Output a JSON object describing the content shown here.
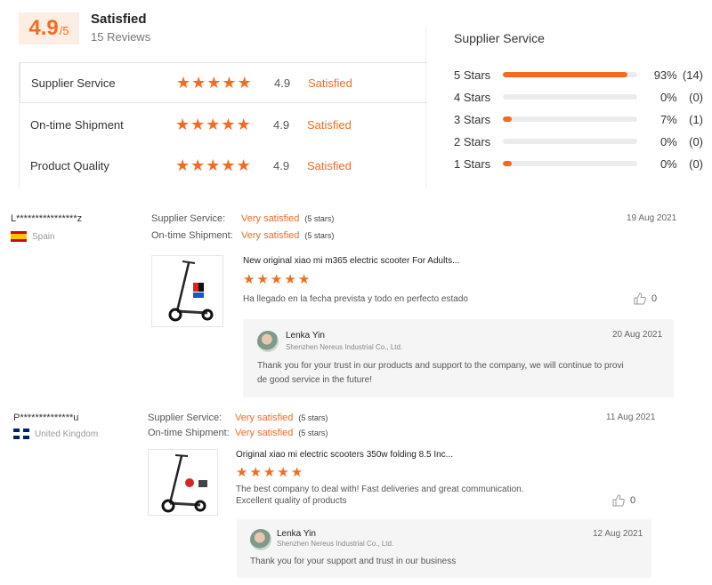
{
  "summary": {
    "score": "4.9",
    "score_of": "/5",
    "status": "Satisfied",
    "reviews_count": "15 Reviews",
    "accent_color": "#f36b21"
  },
  "categories": [
    {
      "name": "Supplier Service",
      "score": "4.9",
      "label": "Satisfied",
      "stars": 5
    },
    {
      "name": "On-time Shipment",
      "score": "4.9",
      "label": "Satisfied",
      "stars": 5
    },
    {
      "name": "Product Quality",
      "score": "4.9",
      "label": "Satisfied",
      "stars": 5
    }
  ],
  "distribution": {
    "title": "Supplier Service",
    "rows": [
      {
        "label": "5 Stars",
        "percent": "93%",
        "count": "(14)",
        "fill": 0.93
      },
      {
        "label": "4 Stars",
        "percent": "0%",
        "count": "(0)",
        "fill": 0
      },
      {
        "label": "3 Stars",
        "percent": "7%",
        "count": "(1)",
        "fill": 0.07
      },
      {
        "label": "2 Stars",
        "percent": "0%",
        "count": "(0)",
        "fill": 0
      },
      {
        "label": "1 Stars",
        "percent": "0%",
        "count": "(0)",
        "fill": 0.07
      }
    ]
  },
  "reviews": [
    {
      "reviewer": "L****************z",
      "country": "Spain",
      "flag_icon": "spain-flag-icon",
      "supplier_key": "Supplier Service:",
      "supplier_val": "Very satisfied",
      "supplier_stars": "(5 stars)",
      "shipment_key": "On-time Shipment:",
      "shipment_val": "Very satisfied",
      "shipment_stars": "(5 stars)",
      "date": "19 Aug 2021",
      "product_title": "New original xiao mi m365 electric scooter For Adults...",
      "rating": 5,
      "comment": "Ha llegado en la fecha prevista y todo en perfecto estado",
      "likes": "0",
      "reply": {
        "name": "Lenka Yin",
        "company": "Shenzhen Nereus Industrial Co., Ltd.",
        "date": "20 Aug 2021",
        "text_line1": "Thank you for your trust in our products and support to the company, we will continue to provi",
        "text_line2": "de good service in the future!"
      }
    },
    {
      "reviewer": "P**************u",
      "country": "United Kingdom",
      "flag_icon": "uk-flag-icon",
      "supplier_key": "Supplier Service:",
      "supplier_val": "Very satisfied",
      "supplier_stars": "(5 stars)",
      "shipment_key": "On-time Shipment:",
      "shipment_val": "Very satisfied",
      "shipment_stars": "(5 stars)",
      "date": "11 Aug 2021",
      "product_title": "Original xiao mi electric scooters 350w folding 8.5 Inc...",
      "rating": 5,
      "comment_line1": "The best company to deal with! Fast deliveries and great communication.",
      "comment_line2": "Excellent quality of products",
      "likes": "0",
      "reply": {
        "name": "Lenka Yin",
        "company": "Shenzhen Nereus Industrial Co., Ltd.",
        "date": "12 Aug 2021",
        "text_line1": "Thank you for your support and trust in our business"
      }
    }
  ]
}
